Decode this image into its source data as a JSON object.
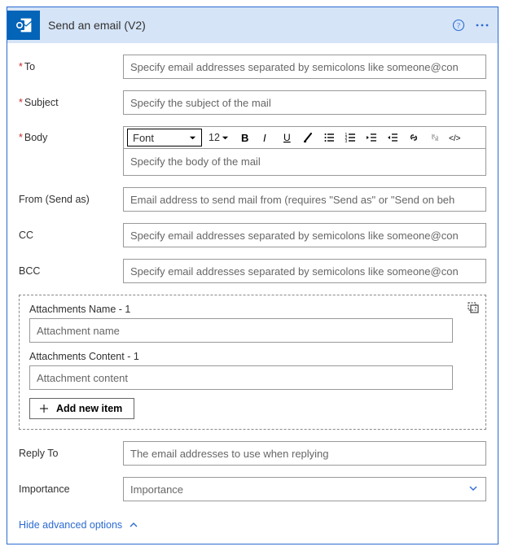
{
  "header": {
    "title": "Send an email (V2)"
  },
  "fields": {
    "to": {
      "label": "To",
      "placeholder": "Specify email addresses separated by semicolons like someone@con"
    },
    "subject": {
      "label": "Subject",
      "placeholder": "Specify the subject of the mail"
    },
    "body": {
      "label": "Body",
      "placeholder": "Specify the body of the mail"
    },
    "from": {
      "label": "From (Send as)",
      "placeholder": "Email address to send mail from (requires \"Send as\" or \"Send on beh"
    },
    "cc": {
      "label": "CC",
      "placeholder": "Specify email addresses separated by semicolons like someone@con"
    },
    "bcc": {
      "label": "BCC",
      "placeholder": "Specify email addresses separated by semicolons like someone@con"
    },
    "replyto": {
      "label": "Reply To",
      "placeholder": "The email addresses to use when replying"
    },
    "importance": {
      "label": "Importance",
      "placeholder": "Importance"
    }
  },
  "editor": {
    "font_label": "Font",
    "size_label": "12"
  },
  "attachments": {
    "name_label": "Attachments Name - 1",
    "name_placeholder": "Attachment name",
    "content_label": "Attachments Content - 1",
    "content_placeholder": "Attachment content",
    "add_label": "Add new item"
  },
  "advanced_toggle": "Hide advanced options"
}
